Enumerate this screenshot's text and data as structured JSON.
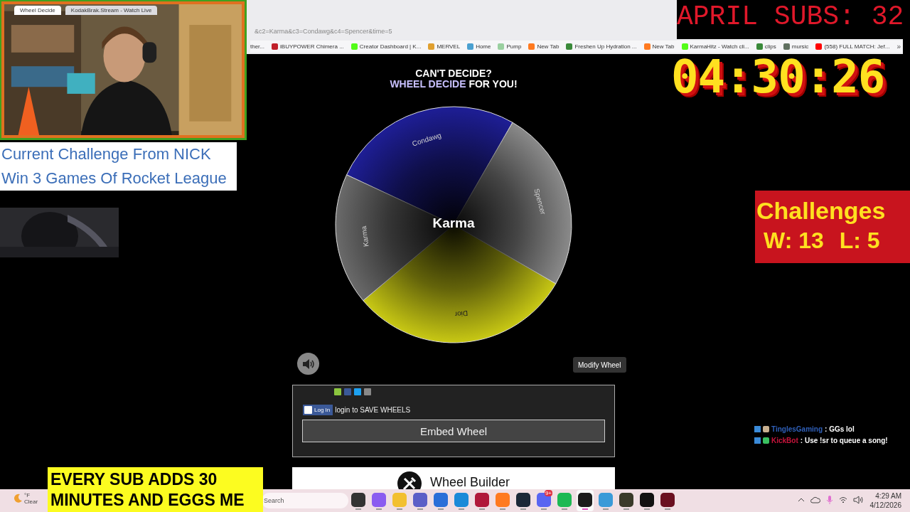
{
  "browser": {
    "tabs": [
      {
        "title": "Wheel Decide",
        "selected": true
      },
      {
        "title": "KodakBrak.Stream - Watch Live",
        "selected": false
      }
    ],
    "address": "&c2=Karma&c3=Condawg&c4=Spencer&time=5",
    "bookmarks": [
      {
        "label": "ther...",
        "kind": "none"
      },
      {
        "label": "iBUYPOWER Chimera ...",
        "kind": "red"
      },
      {
        "label": "Creator Dashboard | K...",
        "kind": "kick"
      },
      {
        "label": "MERVEL",
        "kind": "wheel"
      },
      {
        "label": "Home",
        "kind": "grid"
      },
      {
        "label": "Pump",
        "kind": "pill"
      },
      {
        "label": "New Tab",
        "kind": "firefox"
      },
      {
        "label": "Freshen Up Hydration ...",
        "kind": "leaf"
      },
      {
        "label": "New Tab",
        "kind": "firefox"
      },
      {
        "label": "KarmaHitz - Watch cli...",
        "kind": "kick"
      },
      {
        "label": "clips",
        "kind": "leaf"
      },
      {
        "label": "mursic",
        "kind": "cat"
      },
      {
        "label": "(558) FULL MATCH: Jef...",
        "kind": "video"
      }
    ],
    "more": "»"
  },
  "page": {
    "heading_top": "CAN'T DECIDE?",
    "heading_accent": "WHEEL DECIDE",
    "heading_rest": "FOR YOU!",
    "wheel": {
      "result": "Karma",
      "segments": [
        {
          "label": "Condawg",
          "color": "#1e1e96"
        },
        {
          "label": "Spencer",
          "color": "#8a8a8a"
        },
        {
          "label": "Dior",
          "color": "#c8c814"
        },
        {
          "label": "Karma",
          "color": "#6a6a6a"
        }
      ]
    },
    "modify_button": "Modify Wheel",
    "login_button": "Log In",
    "login_text": "login to SAVE WHEELS",
    "embed_button": "Embed Wheel",
    "builder_title": "Wheel Builder"
  },
  "overlay": {
    "challenge_lines": [
      "Current Challenge From NICK",
      "Win 3 Games Of Rocket League"
    ],
    "subs": "APRIL SUBS: 32",
    "timer": "04:30:26",
    "challenges_title": "Challenges",
    "wins": "W: 13",
    "losses": "L: 5",
    "chat": [
      {
        "user": "TinglesGaming",
        "message": ": GGs lol",
        "color": "#2f5fb8"
      },
      {
        "user": "KickBot",
        "message": ": Use !sr to queue a song!",
        "color": "#c8143c"
      }
    ],
    "banner_lines": [
      "EVERY SUB ADDS 30",
      "MINUTES AND EGGS ME"
    ]
  },
  "taskbar": {
    "weather_unit": "°F",
    "weather_text": "Clear",
    "search_placeholder": "Search",
    "time": "4:29 AM",
    "date": "4/12/2026",
    "apps": [
      {
        "kind": "taskview",
        "selected": false
      },
      {
        "kind": "copilot",
        "selected": false
      },
      {
        "kind": "folder",
        "selected": false
      },
      {
        "kind": "teams",
        "selected": false
      },
      {
        "kind": "store",
        "selected": false
      },
      {
        "kind": "edge",
        "selected": false
      },
      {
        "kind": "red",
        "selected": false
      },
      {
        "kind": "firefox",
        "selected": false
      },
      {
        "kind": "steam",
        "selected": false
      },
      {
        "kind": "discord",
        "selected": false,
        "badge": "9+"
      },
      {
        "kind": "spotify",
        "selected": false
      },
      {
        "kind": "kick",
        "selected": true
      },
      {
        "kind": "photos",
        "selected": false
      },
      {
        "kind": "disc",
        "selected": false
      },
      {
        "kind": "epic",
        "selected": false
      },
      {
        "kind": "game",
        "selected": false
      }
    ]
  }
}
